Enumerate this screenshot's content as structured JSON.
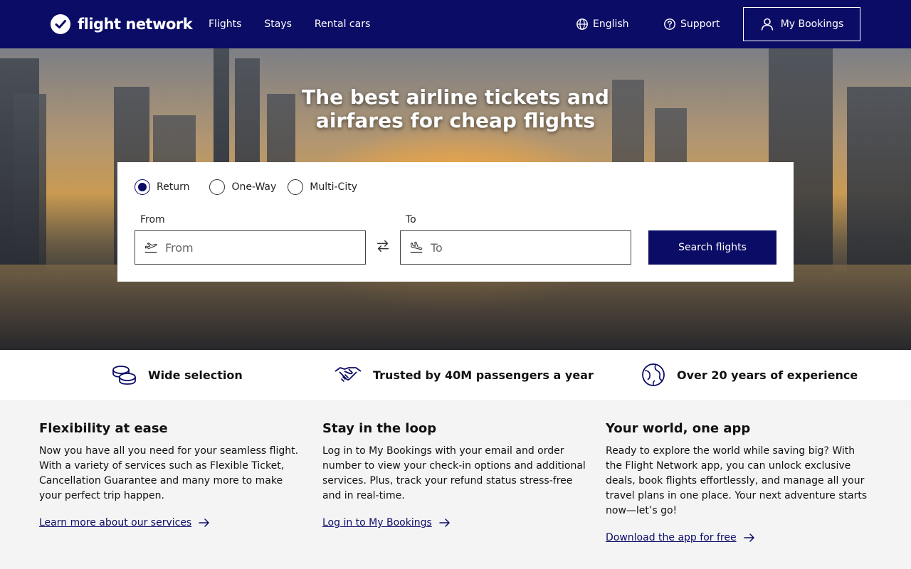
{
  "brand": {
    "name": "flight network",
    "color": "#0b0c66"
  },
  "nav": [
    {
      "label": "Flights"
    },
    {
      "label": "Stays"
    },
    {
      "label": "Rental cars"
    }
  ],
  "header": {
    "language": "English",
    "support": "Support",
    "bookings": "My Bookings"
  },
  "hero": {
    "title": "The best airline tickets and airfares for cheap flights"
  },
  "search": {
    "trip_types": [
      {
        "label": "Return",
        "selected": true
      },
      {
        "label": "One-Way",
        "selected": false
      },
      {
        "label": "Multi-City",
        "selected": false
      }
    ],
    "from_label": "From",
    "from_placeholder": "From",
    "from_value": "",
    "to_label": "To",
    "to_placeholder": "To",
    "to_value": "",
    "button": "Search flights"
  },
  "trust": [
    {
      "icon": "coins-icon",
      "label": "Wide selection"
    },
    {
      "icon": "handshake-icon",
      "label": "Trusted by 40M passengers a year"
    },
    {
      "icon": "globe-icon",
      "label": "Over 20 years of experience"
    }
  ],
  "info": [
    {
      "title": "Flexibility at ease",
      "text": "Now you have all you need for your seamless flight. With a variety of services such as Flexible Ticket, Cancellation Guarantee and many more to make your perfect trip happen.",
      "link": "Learn more about our services"
    },
    {
      "title": "Stay in the loop",
      "text": "Log in to My Bookings with your email and order number to view your check-in options and additional services. Plus, track your refund status stress-free and in real-time.",
      "link": "Log in to My Bookings"
    },
    {
      "title": "Your world, one app",
      "text": "Ready to explore the world while saving big? With the Flight Network app, you can unlock exclusive deals, book flights effortlessly, and manage all your travel plans in one place. Your next adventure starts now—let’s go!",
      "link": "Download the app for free"
    }
  ]
}
